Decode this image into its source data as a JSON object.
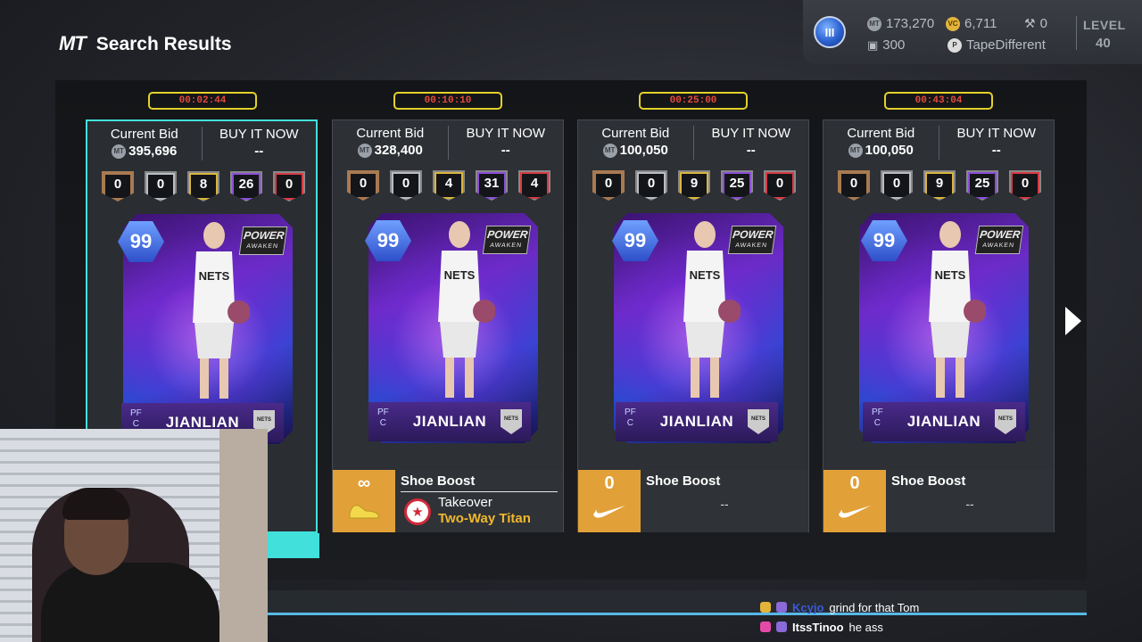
{
  "header": {
    "logo": "MT",
    "title": "Search Results"
  },
  "hud": {
    "mt_balance": "173,270",
    "vc_balance": "6,711",
    "gavel_count": "0",
    "tokens": "300",
    "gamertag": "TapeDifferent",
    "level_label": "LEVEL",
    "level": "40",
    "rank_badge": "III"
  },
  "listings": [
    {
      "timer": "00:02:44",
      "bid_label": "Current Bid",
      "bid": "395,696",
      "bin_label": "BUY IT NOW",
      "bin": "--",
      "badges": [
        "0",
        "0",
        "8",
        "26",
        "0"
      ],
      "ovr": "99",
      "tag": "POWER",
      "tag_sub": "AWAKEN",
      "pos": "PF\nC",
      "name": "JIANLIAN",
      "team": "NETS"
    },
    {
      "timer": "00:10:10",
      "bid_label": "Current Bid",
      "bid": "328,400",
      "bin_label": "BUY IT NOW",
      "bin": "--",
      "badges": [
        "0",
        "0",
        "4",
        "31",
        "4"
      ],
      "ovr": "99",
      "tag": "POWER",
      "tag_sub": "AWAKEN",
      "pos": "PF\nC",
      "name": "JIANLIAN",
      "team": "NETS",
      "shoe": {
        "boost": "∞",
        "title": "Shoe Boost",
        "takeover_label": "Takeover",
        "takeover_value": "Two-Way Titan"
      }
    },
    {
      "timer": "00:25:00",
      "bid_label": "Current Bid",
      "bid": "100,050",
      "bin_label": "BUY IT NOW",
      "bin": "--",
      "badges": [
        "0",
        "0",
        "9",
        "25",
        "0"
      ],
      "ovr": "99",
      "tag": "POWER",
      "tag_sub": "AWAKEN",
      "pos": "PF\nC",
      "name": "JIANLIAN",
      "team": "NETS",
      "shoe": {
        "boost": "0",
        "title": "Shoe Boost",
        "value": "--"
      }
    },
    {
      "timer": "00:43:04",
      "bid_label": "Current Bid",
      "bid": "100,050",
      "bin_label": "BUY IT NOW",
      "bin": "--",
      "badges": [
        "0",
        "0",
        "9",
        "25",
        "0"
      ],
      "ovr": "99",
      "tag": "POWER",
      "tag_sub": "AWAKEN",
      "pos": "PF\nC",
      "name": "JIANLIAN",
      "team": "NETS",
      "shoe": {
        "boost": "0",
        "title": "Shoe Boost",
        "value": "--"
      }
    }
  ],
  "chat": [
    {
      "user": "Kcyjo",
      "message": "grind for that Tom",
      "user_color": "#3a5bd8"
    },
    {
      "user": "ItssTinoo",
      "message": "he ass",
      "user_color": "#ffffff"
    }
  ],
  "colors": {
    "accent": "#42e0da",
    "timer_border": "#e3d12a",
    "timer_text": "#e64a3a",
    "shoe_tile": "#e2a038",
    "takeover_text": "#f0b82a"
  },
  "icons": [
    "rank-badge-icon",
    "mt-coin-icon",
    "vc-coin-icon",
    "gavel-icon",
    "token-icon",
    "playstation-icon",
    "infinity-icon",
    "nike-swoosh-icon",
    "takeover-star-icon",
    "next-arrow-icon"
  ]
}
